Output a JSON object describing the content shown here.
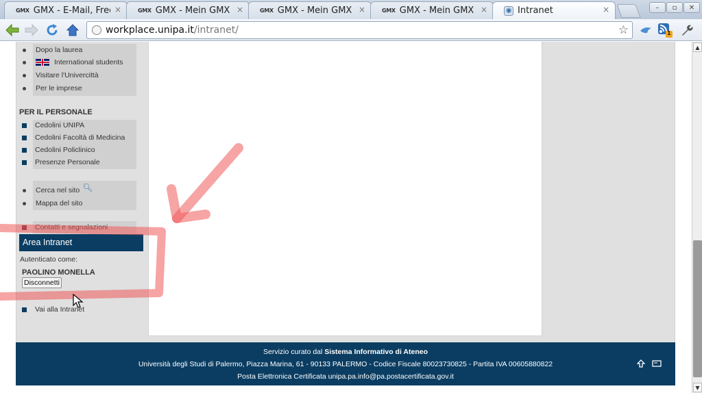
{
  "browser": {
    "tabs": [
      {
        "favicon": "GMX",
        "title": "GMX - E-Mail, FreeMai",
        "close": "×"
      },
      {
        "favicon": "GMX",
        "title": "GMX - Mein GMX",
        "close": "×"
      },
      {
        "favicon": "GMX",
        "title": "GMX - Mein GMX",
        "close": "×"
      },
      {
        "favicon": "GMX",
        "title": "GMX - Mein GMX",
        "close": "×"
      },
      {
        "favicon": "globe-icon",
        "title": "Intranet",
        "close": "×",
        "active": true
      }
    ],
    "window_controls": {
      "minimize": "–",
      "maximize": "▫",
      "close": "✕"
    },
    "address": {
      "host": "workplace.unipa.it",
      "path": "/intranet/"
    },
    "toolbar_icons": [
      "back-arrow-icon",
      "forward-arrow-icon",
      "reload-icon",
      "home-icon",
      "bookmark-star-icon",
      "extension-bird-icon",
      "rss-icon",
      "wrench-icon"
    ],
    "rss_badge": "1"
  },
  "sidebar": {
    "top_items": [
      {
        "label": "Dopo la laurea"
      },
      {
        "label": "International students",
        "flag": "uk-flag-icon"
      },
      {
        "label": "Visitare l'Univercittà"
      },
      {
        "label": "Per le imprese"
      }
    ],
    "personale_heading": "PER IL PERSONALE",
    "personale_items": [
      {
        "label": "Cedolini UNIPA"
      },
      {
        "label": "Cedolini Facoltà di Medicina"
      },
      {
        "label": "Cedolini Policlinico"
      },
      {
        "label": "Presenze Personale"
      }
    ],
    "tools_items": [
      {
        "label": "Cerca nel sito",
        "icon": "magnifier-icon"
      },
      {
        "label": "Mappa del sito"
      }
    ],
    "contact_item": "Contatti e segnalazioni",
    "area_intranet": {
      "title": "Area Intranet",
      "auth_label": "Autenticato come:",
      "user": "PAOLINO MONELLA",
      "logout_button": "Disconnetti",
      "go_link": "Vai alla Intranet"
    }
  },
  "footer": {
    "line1_prefix": "Servizio curato dal ",
    "line1_bold": "Sistema Informativo di Ateneo",
    "line2": "Università degli Studi di Palermo, Piazza Marina, 61 - 90133 PALERMO - Codice Fiscale 80023730825 - Partita IVA 00605880822",
    "line3": "Posta Elettronica Certificata unipa.pa.info@pa.postacertificata.gov.it",
    "icons": [
      "up-arrow-icon",
      "print-icon"
    ]
  },
  "annotation": {
    "color": "#f05a5a",
    "shape": "red-box-and-arrow"
  },
  "colors": {
    "brand_blue": "#0b3d62",
    "sidebar_bg": "#d0d0d0",
    "page_bg": "#e0e0e0"
  }
}
